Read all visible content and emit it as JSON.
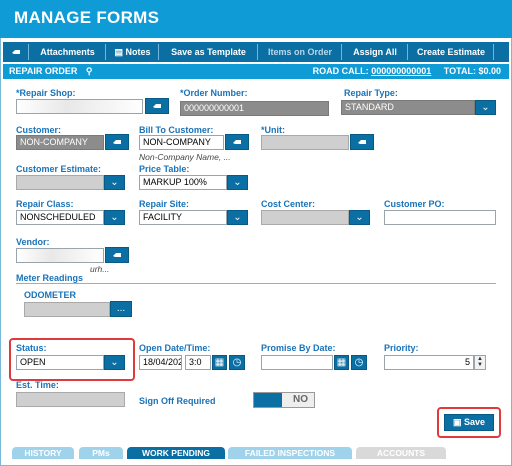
{
  "app": {
    "title": "MANAGE FORMS"
  },
  "toolbar": {
    "attachments": "Attachments",
    "notes": "Notes",
    "save_as_template": "Save as Template",
    "items_on_order": "Items on Order",
    "assign_all": "Assign All",
    "create_estimate": "Create Estimate"
  },
  "header": {
    "section": "REPAIR ORDER",
    "road_call_label": "ROAD CALL:",
    "road_call_value": "000000000001",
    "total_label": "TOTAL:",
    "total_value": "$0.00"
  },
  "form": {
    "repair_shop": {
      "label": "*Repair Shop:",
      "value": ""
    },
    "order_number": {
      "label": "*Order Number:",
      "value": "000000000001"
    },
    "repair_type": {
      "label": "Repair Type:",
      "value": "STANDARD"
    },
    "customer": {
      "label": "Customer:",
      "value": "NON-COMPANY"
    },
    "bill_to_customer": {
      "label": "Bill To Customer:",
      "value": "NON-COMPANY",
      "note": "Non-Company Name, ..."
    },
    "unit": {
      "label": "*Unit:",
      "value": ""
    },
    "customer_estimate": {
      "label": "Customer Estimate:",
      "value": ""
    },
    "price_table": {
      "label": "Price Table:",
      "value": "MARKUP 100%"
    },
    "repair_class": {
      "label": "Repair Class:",
      "value": "NONSCHEDULED"
    },
    "repair_site": {
      "label": "Repair Site:",
      "value": "FACILITY"
    },
    "cost_center": {
      "label": "Cost Center:",
      "value": ""
    },
    "customer_po": {
      "label": "Customer PO:",
      "value": ""
    },
    "vendor": {
      "label": "Vendor:",
      "value": "",
      "note": "urh..."
    },
    "meter_readings": {
      "label": "Meter Readings"
    },
    "odometer": {
      "label": "ODOMETER",
      "value": "",
      "button": "..."
    },
    "status": {
      "label": "Status:",
      "value": "OPEN"
    },
    "open_date": {
      "label": "Open Date/Time:",
      "date": "18/04/202",
      "time": "3:0"
    },
    "promise_by_date": {
      "label": "Promise By Date:",
      "value": ""
    },
    "priority": {
      "label": "Priority:",
      "value": "5"
    },
    "est_time": {
      "label": "Est. Time:",
      "value": ""
    },
    "sign_off": {
      "label": "Sign Off Required",
      "toggle": "NO"
    }
  },
  "save_button": "Save",
  "tabs": [
    "HISTORY",
    "PMs",
    "WORK PENDING",
    "FAILED INSPECTIONS",
    "ACCOUNTS"
  ],
  "colors": {
    "primary": "#0e9bd6",
    "dark": "#0b6fa3",
    "label": "#1a73b8",
    "highlight": "#e03a3a"
  }
}
